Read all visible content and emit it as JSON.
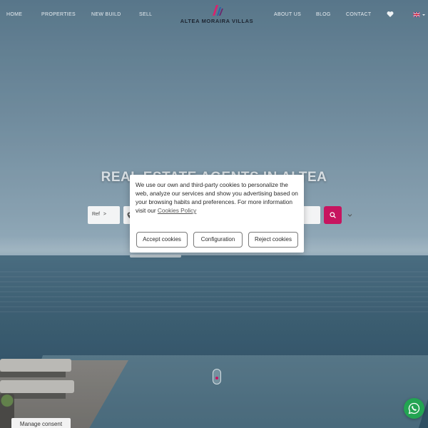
{
  "nav": {
    "left": [
      "HOME",
      "PROPERTIES",
      "NEW BUILD",
      "SELL"
    ],
    "right": [
      "ABOUT US",
      "BLOG",
      "CONTACT"
    ]
  },
  "logo": {
    "text": "ALTEA MORAIRA VILLAS"
  },
  "header_icons": [
    "heart-icon",
    "uk-flag-icon",
    "chevron-down-icon"
  ],
  "hero": {
    "title": "REAL ESTATE AGENTS IN ALTEA"
  },
  "search": {
    "ref_label": "Ref",
    "ref_arrow": ">",
    "location_value": "",
    "icons": [
      "map-pin-icon",
      "chevron-down-icon",
      "search-icon"
    ]
  },
  "cookie": {
    "text": "We use our own and third-party cookies to personalize the web, analyze our services and show you advertising based on your browsing habits and preferences. For more information visit our",
    "link": "Cookies Policy",
    "accept": "Accept cookies",
    "config": "Configuration",
    "reject": "Reject cookies"
  },
  "manage_consent": "Manage consent",
  "colors": {
    "accent": "#c7145f",
    "whatsapp": "#23a452",
    "logo_pink": "#d6246e",
    "logo_blue": "#2c5fa8"
  }
}
